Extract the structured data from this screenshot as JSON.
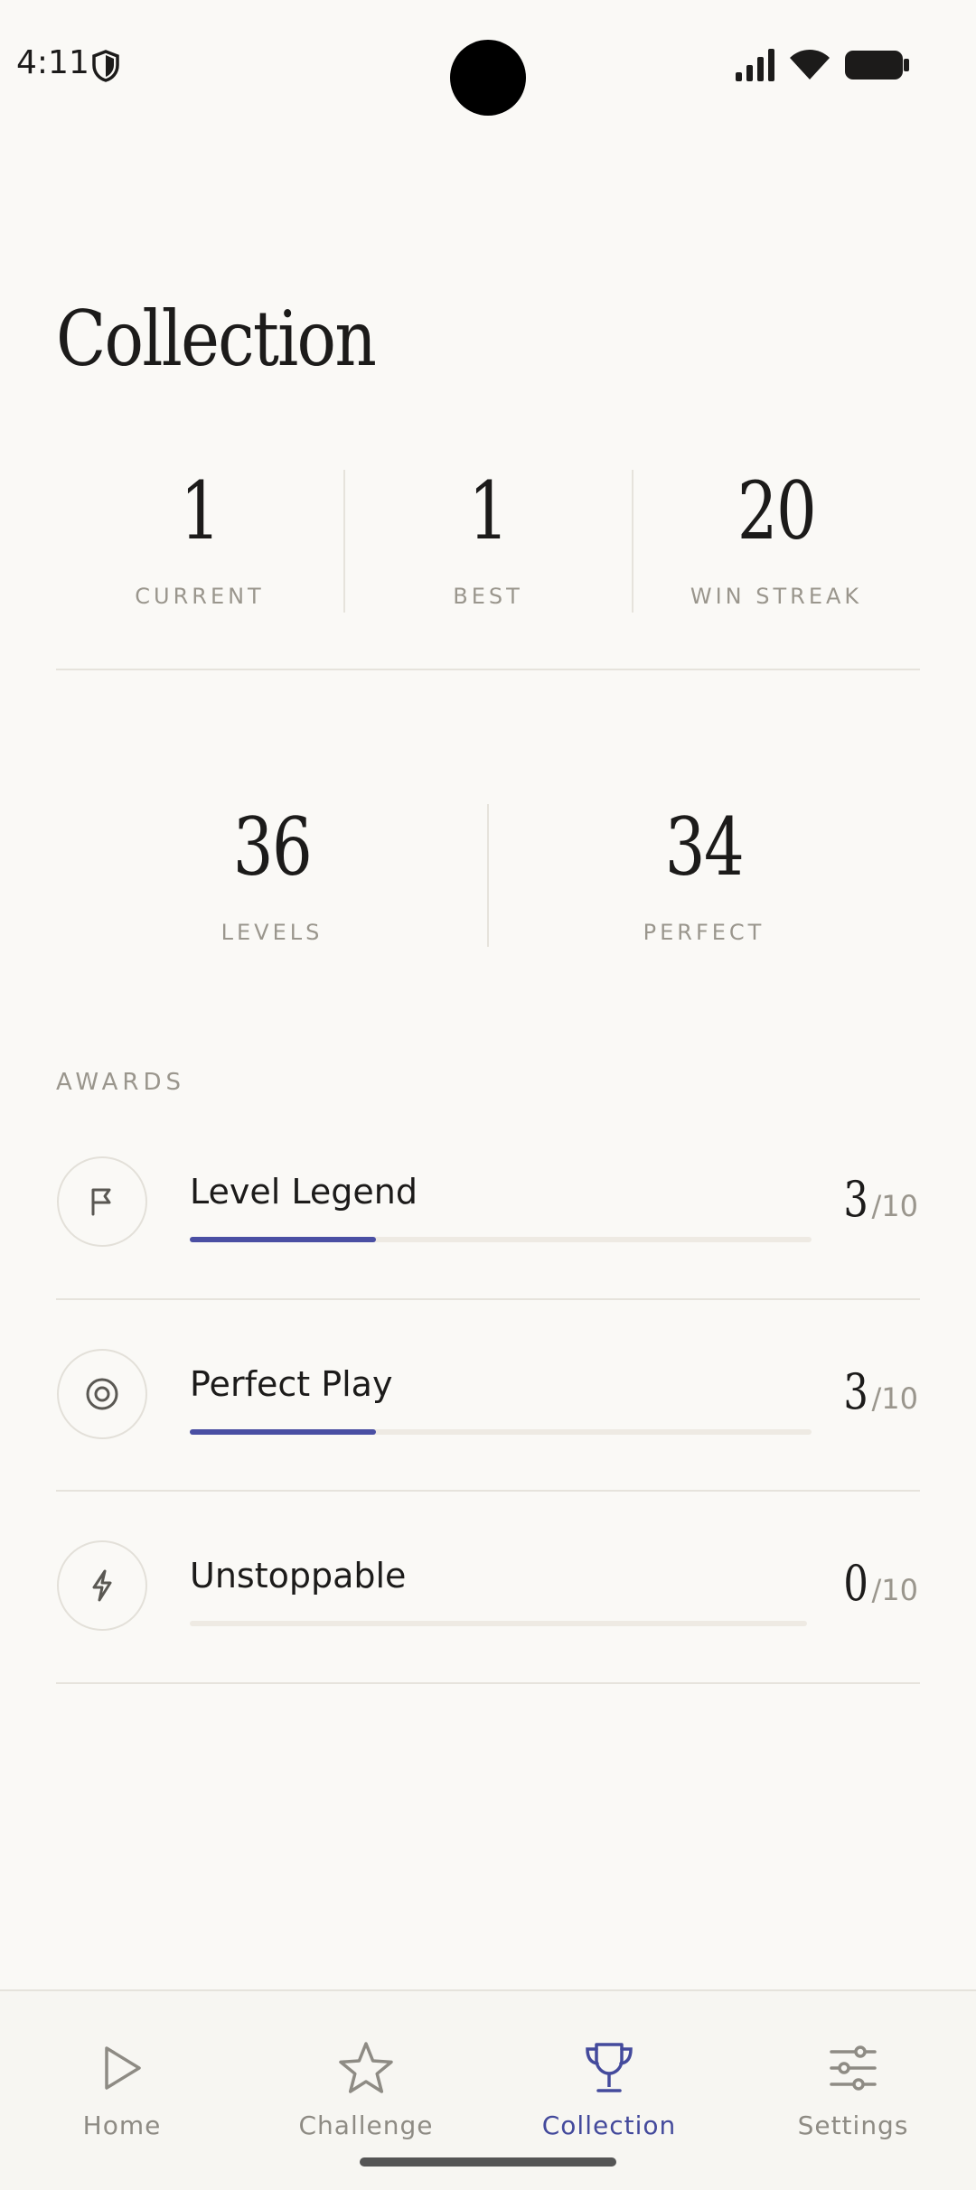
{
  "status_bar": {
    "time": "4:11",
    "icons": [
      "shield-icon",
      "signal-icon",
      "wifi-icon",
      "battery-icon"
    ]
  },
  "page": {
    "title": "Collection"
  },
  "streak_stats": [
    {
      "value": "1",
      "label": "CURRENT"
    },
    {
      "value": "1",
      "label": "BEST"
    },
    {
      "value": "20",
      "label": "WIN STREAK"
    }
  ],
  "level_stats": [
    {
      "value": "36",
      "label": "LEVELS"
    },
    {
      "value": "34",
      "label": "PERFECT"
    }
  ],
  "awards": {
    "section_label": "AWARDS",
    "items": [
      {
        "name": "Level Legend",
        "icon": "flag-icon",
        "count": "3",
        "total": "/10",
        "progress": 0.3
      },
      {
        "name": "Perfect Play",
        "icon": "target-icon",
        "count": "3",
        "total": "/10",
        "progress": 0.3
      },
      {
        "name": "Unstoppable",
        "icon": "lightning-icon",
        "count": "0",
        "total": "/10",
        "progress": 0
      }
    ]
  },
  "nav": {
    "active": "Collection",
    "accent": "#444a9c",
    "items": [
      {
        "label": "Home",
        "icon": "play-icon"
      },
      {
        "label": "Challenge",
        "icon": "star-icon"
      },
      {
        "label": "Collection",
        "icon": "trophy-icon"
      },
      {
        "label": "Settings",
        "icon": "sliders-icon"
      }
    ]
  }
}
